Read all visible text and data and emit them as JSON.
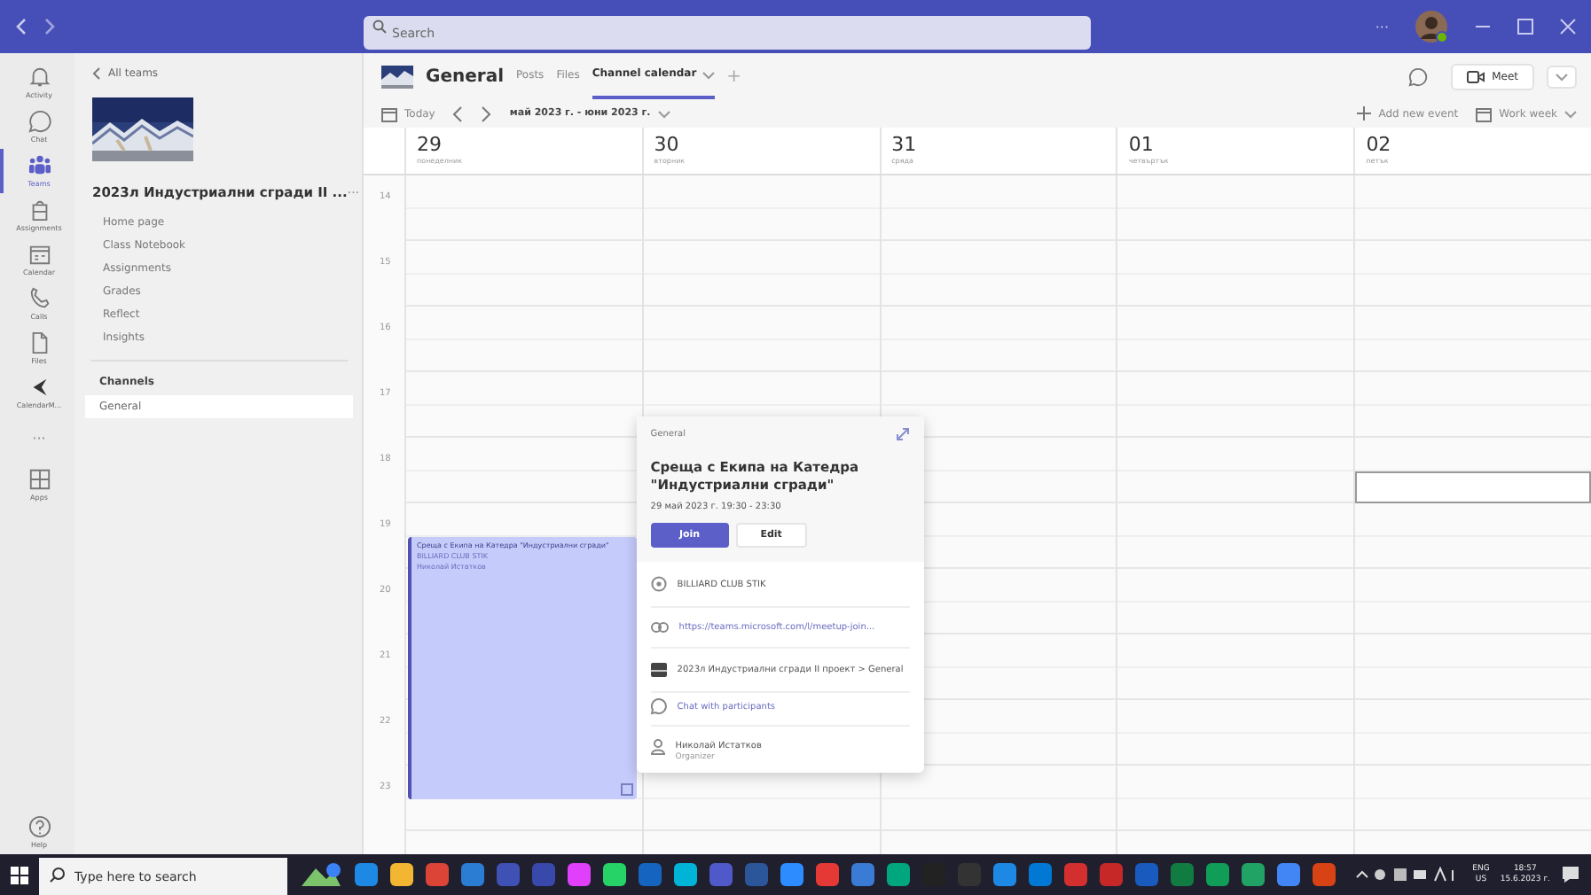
{
  "titlebar": {
    "search_placeholder": "Search",
    "more": "···"
  },
  "rail": [
    {
      "kind": "bell",
      "label": "Activity",
      "selected": false
    },
    {
      "kind": "chat",
      "label": "Chat",
      "selected": false
    },
    {
      "kind": "teams",
      "label": "Teams",
      "selected": true
    },
    {
      "kind": "bag",
      "label": "Assignments",
      "selected": false
    },
    {
      "kind": "calendar",
      "label": "Calendar",
      "selected": false
    },
    {
      "kind": "phone",
      "label": "Calls",
      "selected": false
    },
    {
      "kind": "file",
      "label": "Files",
      "selected": false
    },
    {
      "kind": "app",
      "label": "CalendarM...",
      "selected": false
    },
    {
      "kind": "more",
      "label": "···",
      "selected": false
    },
    {
      "kind": "apps",
      "label": "Apps",
      "selected": false
    }
  ],
  "rail_help": {
    "label": "Help"
  },
  "team_panel": {
    "back": "All teams",
    "team_name": "2023л Индустриални сгради II ...",
    "more": "···",
    "nav": [
      "Home page",
      "Class Notebook",
      "Assignments",
      "Grades",
      "Reflect",
      "Insights"
    ],
    "channels_heading": "Channels",
    "channels": [
      {
        "name": "General",
        "selected": true
      }
    ]
  },
  "channel_header": {
    "name": "General",
    "tabs": [
      {
        "label": "Posts",
        "selected": false
      },
      {
        "label": "Files",
        "selected": false
      },
      {
        "label": "Channel calendar",
        "selected": true
      }
    ],
    "add": "+",
    "meet": "Meet"
  },
  "toolbar": {
    "today": "Today",
    "range": "май 2023 г. - юни 2023 г.",
    "add_event": "Add new event",
    "view": "Work week"
  },
  "days": [
    {
      "date": "29",
      "weekday": "понеделник"
    },
    {
      "date": "30",
      "weekday": "вторник"
    },
    {
      "date": "31",
      "weekday": "сряда"
    },
    {
      "date": "01",
      "weekday": "четвъртък"
    },
    {
      "date": "02",
      "weekday": "петък"
    }
  ],
  "hours": [
    "14",
    "15",
    "16",
    "17",
    "18",
    "19",
    "20",
    "21",
    "22",
    "23"
  ],
  "event": {
    "title": "Среща с Екипа на Катедра \"Индустриални сгради\"",
    "location": "BILLIARD CLUB STIK",
    "organizer": "Николай Истатков"
  },
  "popover": {
    "channel": "General",
    "title": "Среща с Екипа на Катедра \"Индустриални сгради\"",
    "when": "29 май 2023 г. 19:30 - 23:30",
    "join": "Join",
    "edit": "Edit",
    "location": "BILLIARD CLUB STIK",
    "link": "https://teams.microsoft.com/l/meetup-join...",
    "team": "2023л Индустриални сгради II проект > General",
    "chat": "Chat with participants",
    "organizer": "Николай Истатков",
    "role": "Organizer"
  },
  "taskbar": {
    "search_placeholder": "Type here to search",
    "apps": [
      {
        "color": "#1e88e5"
      },
      {
        "color": "#f2b632"
      },
      {
        "color": "#db4437"
      },
      {
        "color": "#2b7cd3"
      },
      {
        "color": "#3f51b5"
      },
      {
        "color": "#3949ab"
      },
      {
        "color": "#e040fb"
      },
      {
        "color": "#25d366"
      },
      {
        "color": "#1565c0"
      },
      {
        "color": "#00b4d8"
      },
      {
        "color": "#5059c9"
      },
      {
        "color": "#2b579a"
      },
      {
        "color": "#2d8cff"
      },
      {
        "color": "#e53935"
      },
      {
        "color": "#3a7bd5"
      },
      {
        "color": "#00a67e"
      },
      {
        "color": "#222222"
      },
      {
        "color": "#333333"
      },
      {
        "color": "#1e88e5"
      },
      {
        "color": "#0078d4"
      },
      {
        "color": "#d32f2f"
      },
      {
        "color": "#c62828"
      },
      {
        "color": "#185abd"
      },
      {
        "color": "#107c41"
      },
      {
        "color": "#0f9d58"
      },
      {
        "color": "#21a366"
      },
      {
        "color": "#4285f4"
      },
      {
        "color": "#d84315"
      }
    ],
    "lang": "ENG",
    "region": "US",
    "time": "18:57",
    "date": "15.6.2023 г."
  }
}
